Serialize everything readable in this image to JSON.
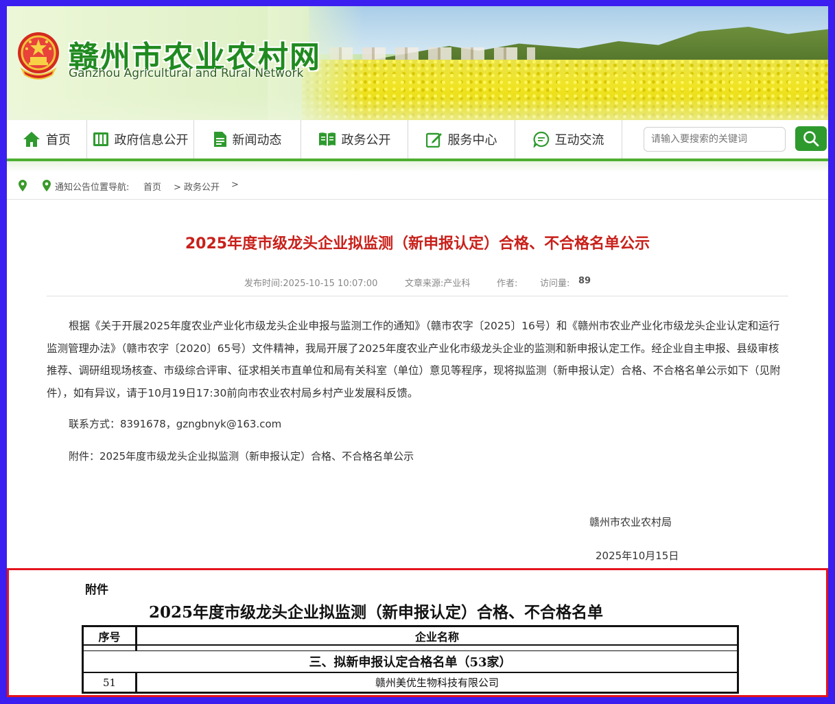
{
  "site": {
    "title": "赣州市农业农村网",
    "subtitle": "Ganzhou Agricultural and Rural Network"
  },
  "nav": {
    "items": [
      {
        "label": "首页",
        "icon": "home-icon"
      },
      {
        "label": "政府信息公开",
        "icon": "columns-icon"
      },
      {
        "label": "新闻动态",
        "icon": "document-icon"
      },
      {
        "label": "政务公开",
        "icon": "book-icon"
      },
      {
        "label": "服务中心",
        "icon": "edit-icon"
      },
      {
        "label": "互动交流",
        "icon": "chat-icon"
      }
    ],
    "search_placeholder": "请输入要搜索的关键词",
    "accent": "#4caf30"
  },
  "breadcrumb": {
    "label": "通知公告位置导航:",
    "home": "首页",
    "section": "> 政务公开",
    "tail": ">"
  },
  "article": {
    "title": "2025年度市级龙头企业拟监测（新申报认定）合格、不合格名单公示",
    "publish_time": "发布时间:2025-10-15 10:07:00",
    "source": "文章来源:产业科",
    "author_label": "作者:",
    "views_label": "访问量:",
    "views": "89",
    "body": "根据《关于开展2025年度农业产业化市级龙头企业申报与监测工作的通知》（赣市农字〔2025〕16号）和《赣州市农业产业化市级龙头企业认定和运行监测管理办法》（赣市农字〔2020〕65号）文件精神，我局开展了2025年度农业产业化市级龙头企业的监测和新申报认定工作。经企业自主申报、县级审核推荐、调研组现场核查、市级综合评审、征求相关市直单位和局有关科室（单位）意见等程序，现将拟监测（新申报认定）合格、不合格名单公示如下（见附件），如有异议，请于10月19日17:30前向市农业农村局乡村产业发展科反馈。",
    "contact": "联系方式：8391678，gzngbnyk@163.com",
    "attachment": "附件：2025年度市级龙头企业拟监测（新申报认定）合格、不合格名单公示",
    "signer": "赣州市农业农村局",
    "date": "2025年10月15日",
    "title_color": "#c8201a"
  },
  "attachment_image": {
    "label": "附件",
    "title": "2025年度市级龙头企业拟监测（新申报认定）合格、不合格名单",
    "col_no": "序号",
    "col_name": "企业名称",
    "section_heading": "三、拟新申报认定合格名单（53家）",
    "rows": [
      {
        "no": "51",
        "name": "赣州美优生物科技有限公司"
      }
    ],
    "highlight_color": "#e4141e"
  }
}
